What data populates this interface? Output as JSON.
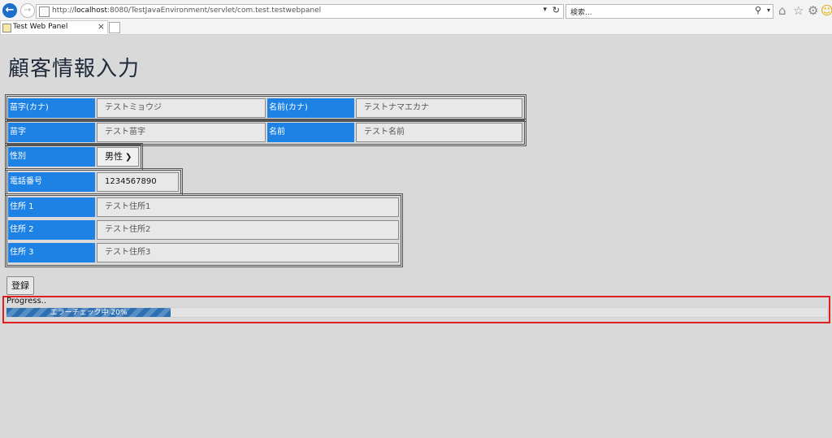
{
  "browser": {
    "url_prefix": "http://",
    "url_host": "localhost",
    "url_rest": ":8080/TestJavaEnvironment/servlet/com.test.testwebpanel",
    "search_placeholder": "検索...",
    "tab_title": "Test Web Panel",
    "icons": [
      "back-icon",
      "forward-icon",
      "refresh-icon",
      "search-icon",
      "home-icon",
      "favorites-icon",
      "settings-icon",
      "smiley-icon"
    ]
  },
  "page": {
    "title": "顧客情報入力"
  },
  "form": {
    "sei_kana": {
      "label": "苗字(カナ)",
      "placeholder": "テストミョウジ"
    },
    "mei_kana": {
      "label": "名前(カナ)",
      "placeholder": "テストナマエカナ"
    },
    "sei": {
      "label": "苗字",
      "placeholder": "テスト苗字"
    },
    "mei": {
      "label": "名前",
      "placeholder": "テスト名前"
    },
    "gender": {
      "label": "性別",
      "selected": "男性"
    },
    "phone": {
      "label": "電話番号",
      "value": "1234567890"
    },
    "address1": {
      "label": "住所 1",
      "placeholder": "テスト住所1"
    },
    "address2": {
      "label": "住所 2",
      "placeholder": "テスト住所2"
    },
    "address3": {
      "label": "住所 3",
      "placeholder": "テスト住所3"
    },
    "submit_label": "登録"
  },
  "progress": {
    "label": "Progress..",
    "text": "エラーチェック中 20%",
    "percent": 20,
    "colors": {
      "bar": "#2d6fb0",
      "highlight_border": "#e01f1f",
      "label_bg": "#1e82e5"
    }
  }
}
